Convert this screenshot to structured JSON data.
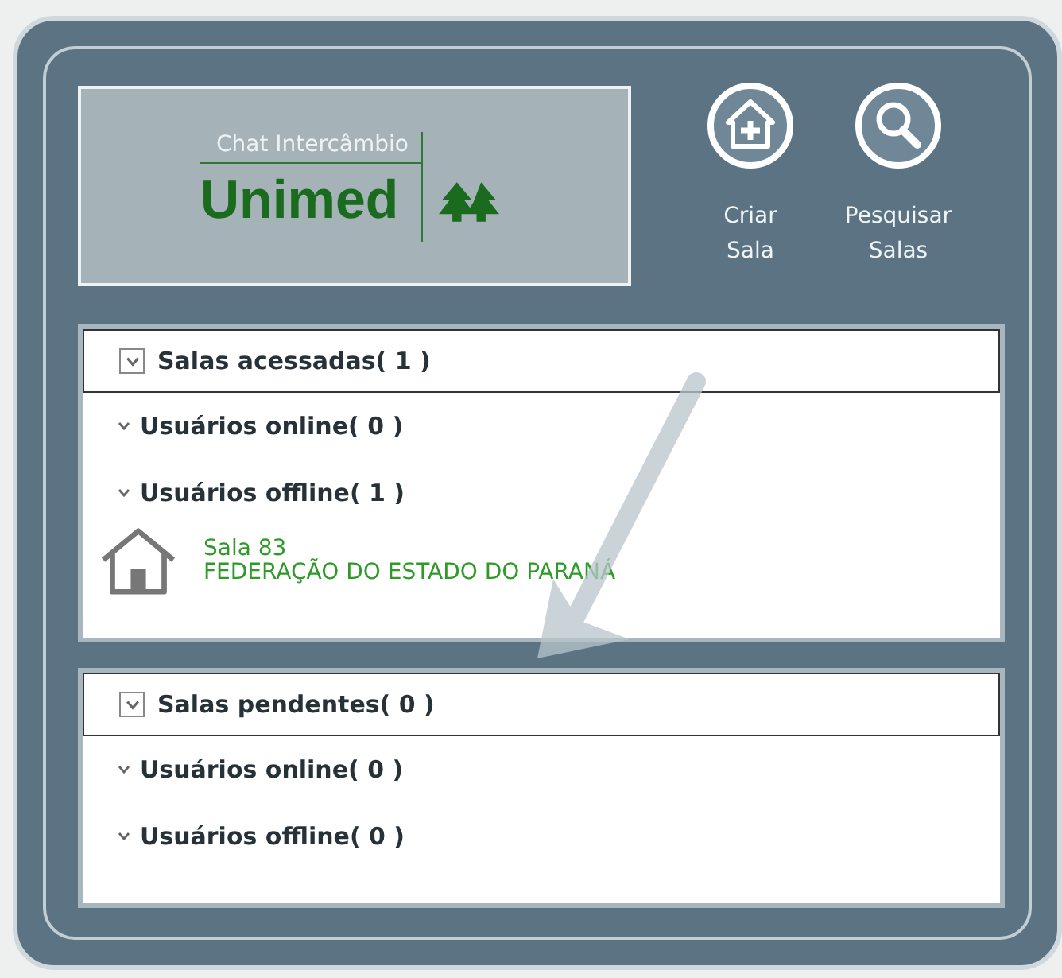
{
  "logo": {
    "caption": "Chat Intercâmbio",
    "wordmark": "Unimed"
  },
  "actions": [
    {
      "kind": "create",
      "label": "Criar\nSala"
    },
    {
      "kind": "search",
      "label": "Pesquisar\nSalas"
    }
  ],
  "sections": [
    {
      "title": "Salas acessadas( 1 )",
      "groups": [
        {
          "label": "Usuários online( 0 )"
        },
        {
          "label": "Usuários offline( 1 )"
        }
      ],
      "rooms": [
        {
          "name": "Sala 83",
          "organization": "FEDERAÇÃO DO ESTADO DO PARANÁ"
        }
      ]
    },
    {
      "title": "Salas pendentes( 0 )",
      "groups": [
        {
          "label": "Usuários online( 0 )"
        },
        {
          "label": "Usuários offline( 0 )"
        }
      ]
    }
  ]
}
